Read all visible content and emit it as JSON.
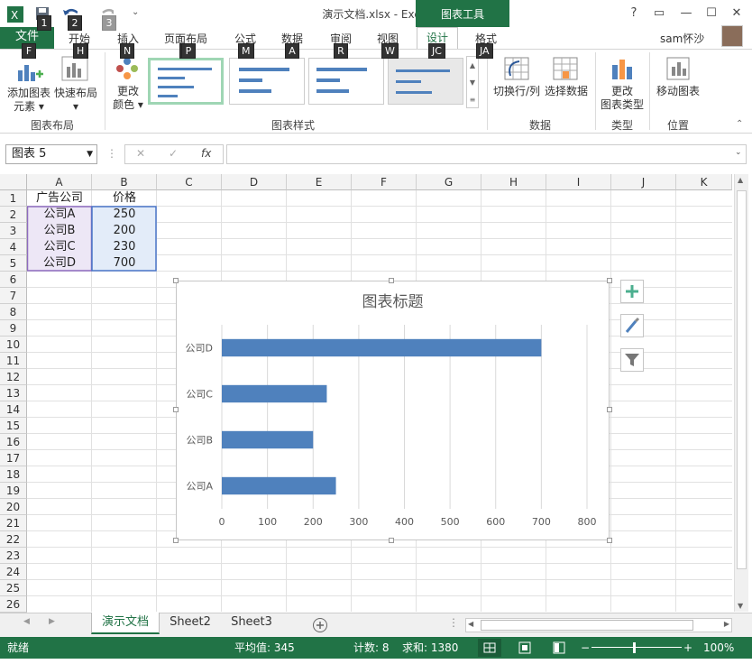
{
  "window": {
    "title": "演示文档.xlsx - Excel",
    "context_tab_title": "图表工具",
    "help": "?",
    "user": "sam怀沙"
  },
  "keytips": {
    "save": "1",
    "undo": "2",
    "redo": "3",
    "file": "F",
    "home": "H",
    "insert": "N",
    "layout": "P",
    "formulas": "M",
    "data": "A",
    "review": "R",
    "view": "W",
    "design": "JC",
    "format": "JA"
  },
  "tabs": {
    "file": "文件",
    "home": "开始",
    "insert": "插入",
    "page_layout": "页面布局",
    "formulas": "公式",
    "data": "数据",
    "review": "审阅",
    "view": "视图",
    "design": "设计",
    "format": "格式"
  },
  "ribbon": {
    "add_element": "添加图表",
    "add_element2": "元素",
    "quick_layout": "快速布局",
    "change_color": "更改",
    "change_color2": "颜色",
    "group_layouts": "图表布局",
    "group_styles": "图表样式",
    "switch_row_col": "切换行/列",
    "select_data": "选择数据",
    "group_data": "数据",
    "change_type": "更改",
    "change_type2": "图表类型",
    "group_type": "类型",
    "move_chart": "移动图表",
    "group_location": "位置"
  },
  "formula_bar": {
    "name_box": "图表 5",
    "fx": "fx",
    "cancel": "✕",
    "enter": "✓",
    "value": ""
  },
  "columns": [
    "A",
    "B",
    "C",
    "D",
    "E",
    "F",
    "G",
    "H",
    "I",
    "J",
    "K"
  ],
  "rows": [
    "1",
    "2",
    "3",
    "4",
    "5",
    "6",
    "7",
    "8",
    "9",
    "10",
    "11",
    "12",
    "13",
    "14",
    "15",
    "16",
    "17",
    "18",
    "19",
    "20",
    "21",
    "22",
    "23",
    "24",
    "25",
    "26"
  ],
  "cells": {
    "A1": "广告公司",
    "B1": "价格",
    "A2": "公司A",
    "B2": "250",
    "A3": "公司B",
    "B3": "200",
    "A4": "公司C",
    "B4": "230",
    "A5": "公司D",
    "B5": "700"
  },
  "chart_data": {
    "type": "bar",
    "orientation": "horizontal",
    "title": "图表标题",
    "categories": [
      "公司A",
      "公司B",
      "公司C",
      "公司D"
    ],
    "values": [
      250,
      200,
      230,
      700
    ],
    "xlim": [
      0,
      800
    ],
    "x_ticks": [
      "0",
      "100",
      "200",
      "300",
      "400",
      "500",
      "600",
      "700",
      "800"
    ],
    "grid": true,
    "bar_color": "#4f81bd"
  },
  "sheets": {
    "tabs": [
      "演示文档",
      "Sheet2",
      "Sheet3"
    ],
    "active": "演示文档"
  },
  "status": {
    "ready": "就绪",
    "average": "平均值: 345",
    "count": "计数: 8",
    "sum": "求和: 1380",
    "zoom": "100%"
  },
  "colors": {
    "accent": "#217346",
    "bar": "#4f81bd"
  }
}
